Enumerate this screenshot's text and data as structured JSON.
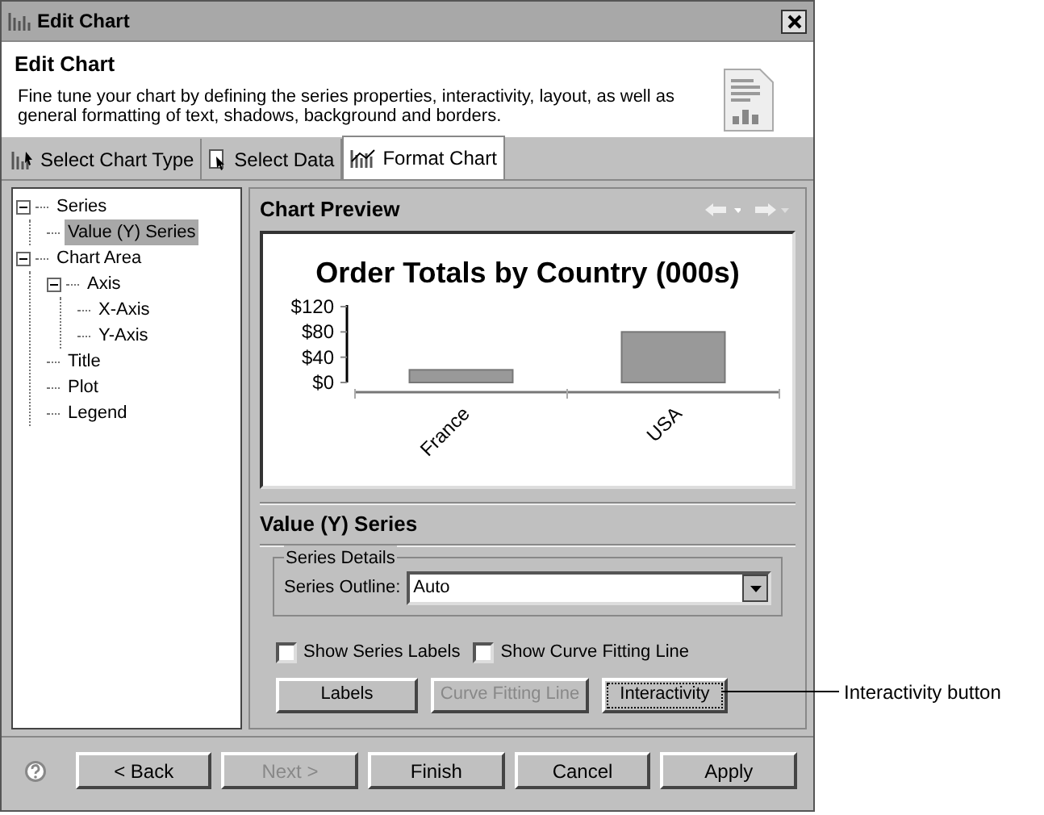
{
  "window": {
    "title": "Edit Chart"
  },
  "header": {
    "title": "Edit Chart",
    "description": "Fine tune your chart by defining the series properties, interactivity, layout, as well as general formatting of text, shadows, background and borders."
  },
  "tabs": [
    {
      "label": "Select Chart Type",
      "selected": false
    },
    {
      "label": "Select Data",
      "selected": false
    },
    {
      "label": "Format Chart",
      "selected": true
    }
  ],
  "tree": [
    {
      "label": "Series",
      "expanded": true,
      "selected": false,
      "children": [
        {
          "label": "Value (Y) Series",
          "selected": true
        }
      ]
    },
    {
      "label": "Chart Area",
      "expanded": true,
      "selected": false,
      "children": [
        {
          "label": "Axis",
          "expanded": true,
          "selected": false,
          "children": [
            {
              "label": "X-Axis",
              "selected": false
            },
            {
              "label": "Y-Axis",
              "selected": false
            }
          ]
        },
        {
          "label": "Title",
          "selected": false
        },
        {
          "label": "Plot",
          "selected": false
        },
        {
          "label": "Legend",
          "selected": false
        }
      ]
    }
  ],
  "preview": {
    "title": "Chart Preview",
    "chart_data": {
      "type": "bar",
      "title": "Order Totals by Country (000s)",
      "categories": [
        "France",
        "USA"
      ],
      "series": [
        {
          "color": "#999999",
          "values": [
            20,
            80
          ]
        }
      ],
      "ylim": [
        0,
        120
      ],
      "yticks": [
        {
          "value": 0,
          "label": "$0"
        },
        {
          "value": 40,
          "label": "$40"
        },
        {
          "value": 80,
          "label": "$80"
        },
        {
          "value": 120,
          "label": "$120"
        }
      ]
    }
  },
  "series_panel": {
    "title": "Value (Y) Series",
    "group_title": "Series Details",
    "outline_label": "Series Outline:",
    "outline_value": "Auto",
    "checkboxes": [
      {
        "label": "Show Series Labels",
        "checked": false
      },
      {
        "label": "Show Curve Fitting Line",
        "checked": false
      }
    ],
    "buttons": [
      {
        "label": "Labels",
        "disabled": false,
        "focused": false
      },
      {
        "label": "Curve Fitting Line",
        "disabled": true,
        "focused": false
      },
      {
        "label": "Interactivity",
        "disabled": false,
        "focused": true
      }
    ]
  },
  "footer_buttons": [
    {
      "label": "< Back",
      "disabled": false
    },
    {
      "label": "Next >",
      "disabled": true
    },
    {
      "label": "Finish",
      "disabled": false
    },
    {
      "label": "Cancel",
      "disabled": false
    },
    {
      "label": "Apply",
      "disabled": false
    }
  ],
  "callout": "Interactivity button"
}
